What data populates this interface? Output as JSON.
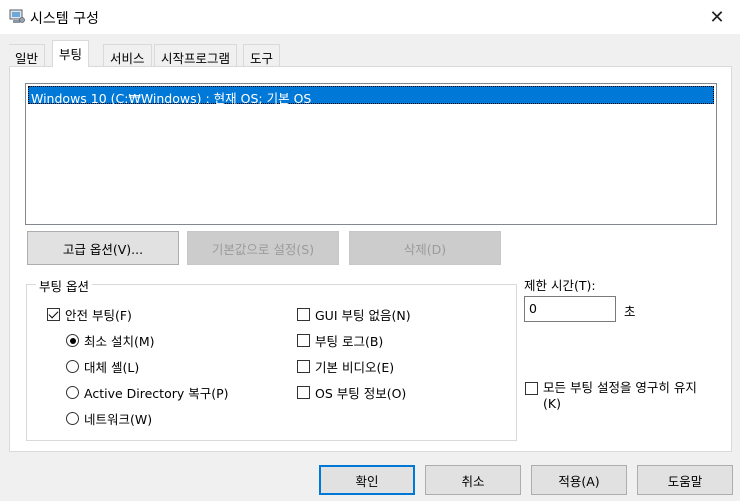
{
  "window": {
    "title": "시스템 구성",
    "icon": "system-config-icon",
    "close": "✕"
  },
  "tabs": [
    {
      "label": "일반"
    },
    {
      "label": "부팅"
    },
    {
      "label": "서비스"
    },
    {
      "label": "시작프로그램"
    },
    {
      "label": "도구"
    }
  ],
  "active_tab": "부팅",
  "os_list": {
    "items": [
      "Windows 10 (C:₩Windows) : 현재 OS; 기본 OS"
    ],
    "selected_index": 0
  },
  "buttons": {
    "advanced": "고급 옵션(V)...",
    "set_default": "기본값으로 설정(S)",
    "delete": "삭제(D)"
  },
  "boot_options": {
    "legend": "부팅 옵션",
    "safe_boot": {
      "label": "안전 부팅(F)",
      "checked": true
    },
    "minimal": {
      "label": "최소 설치(M)",
      "selected": true
    },
    "alternate_shell": {
      "label": "대체 셸(L)",
      "selected": false
    },
    "ad_repair": {
      "label": "Active Directory 복구(P)",
      "selected": false
    },
    "network": {
      "label": "네트워크(W)",
      "selected": false
    },
    "no_gui": {
      "label": "GUI 부팅 없음(N)",
      "checked": false
    },
    "boot_log": {
      "label": "부팅 로그(B)",
      "checked": false
    },
    "base_video": {
      "label": "기본 비디오(E)",
      "checked": false
    },
    "os_boot_info": {
      "label": "OS 부팅 정보(O)",
      "checked": false
    }
  },
  "timeout": {
    "label": "제한 시간(T):",
    "value": "0",
    "unit": "초"
  },
  "persistent": {
    "label_line1": "모든 부팅 설정을 영구히 유지",
    "label_line2": "(K)",
    "checked": false
  },
  "footer": {
    "ok": "확인",
    "cancel": "취소",
    "apply": "적용(A)",
    "help": "도움말"
  },
  "colors": {
    "selection": "#0078d7",
    "primary_border": "#0078d7"
  }
}
